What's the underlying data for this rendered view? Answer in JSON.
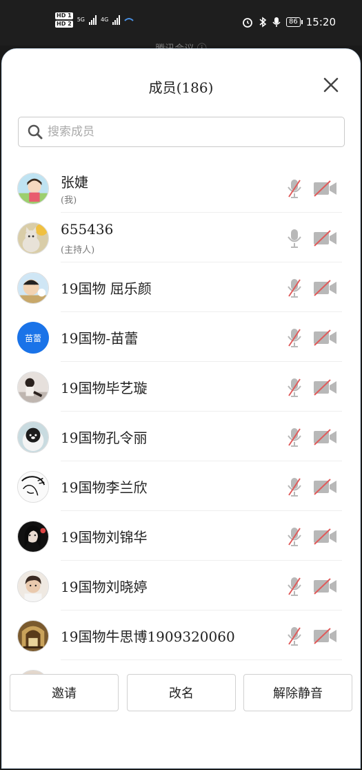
{
  "status_bar": {
    "hd1": "HD 1",
    "hd2": "HD 2",
    "net1": "5G",
    "net2": "4G",
    "battery": "86",
    "time": "15:20"
  },
  "background_title": "腾讯会议 ⓘ",
  "header": {
    "title": "成员(186)"
  },
  "search": {
    "placeholder": "搜索成员"
  },
  "members": [
    {
      "name": "张婕",
      "tag": "(我)",
      "mic_muted": true,
      "video_off": true,
      "avatar": "cartoon-girl"
    },
    {
      "name": "655436",
      "tag": "(主持人)",
      "mic_muted": false,
      "video_off": true,
      "avatar": "cat"
    },
    {
      "name": "19国物 屈乐颜",
      "tag": "",
      "mic_muted": true,
      "video_off": true,
      "avatar": "crayon-shin"
    },
    {
      "name": "19国物-苗蕾",
      "tag": "",
      "mic_muted": true,
      "video_off": true,
      "avatar_text": "苗蕾"
    },
    {
      "name": "19国物毕艺璇",
      "tag": "",
      "mic_muted": true,
      "video_off": true,
      "avatar": "photo-girl"
    },
    {
      "name": "19国物孔令丽",
      "tag": "",
      "mic_muted": true,
      "video_off": true,
      "avatar": "bear"
    },
    {
      "name": "19国物李兰欣",
      "tag": "",
      "mic_muted": true,
      "video_off": true,
      "avatar": "sketch"
    },
    {
      "name": "19国物刘锦华",
      "tag": "",
      "mic_muted": true,
      "video_off": true,
      "avatar": "dark-girl"
    },
    {
      "name": "19国物刘晓婷",
      "tag": "",
      "mic_muted": true,
      "video_off": true,
      "avatar": "boy"
    },
    {
      "name": "19国物牛思博1909320060",
      "tag": "",
      "mic_muted": true,
      "video_off": true,
      "avatar": "library"
    }
  ],
  "footer": {
    "invite": "邀请",
    "rename": "改名",
    "unmute": "解除静音"
  }
}
